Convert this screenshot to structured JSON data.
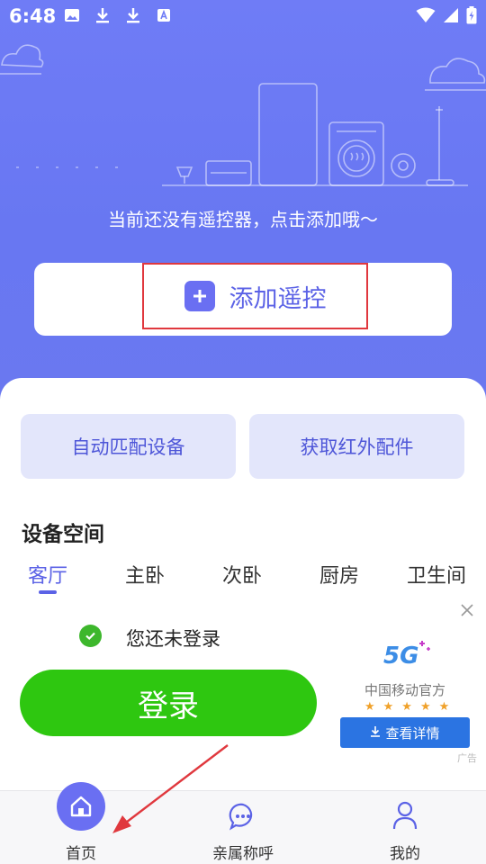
{
  "status_bar": {
    "time": "6:48"
  },
  "hero": {
    "hint": "当前还没有遥控器，点击添加哦～",
    "add_remote_label": "添加遥控"
  },
  "actions": {
    "auto_match": "自动匹配设备",
    "ir_accessory": "获取红外配件"
  },
  "rooms": {
    "title": "设备空间",
    "tabs": [
      "客厅",
      "主卧",
      "次卧",
      "厨房",
      "卫生间"
    ],
    "active": "客厅"
  },
  "ad": {
    "login_hint": "您还未登录",
    "login_button": "登录",
    "brand_name": "中国移动官方",
    "stars": "★★★★★",
    "detail_button": "查看详情",
    "ad_tag": "广告",
    "logo": "5G"
  },
  "nav": {
    "home": "首页",
    "family": "亲属称呼",
    "mine": "我的"
  },
  "colors": {
    "accent": "#5b62e6",
    "hero": "#6a78f0",
    "login_green": "#2ec710",
    "highlight_red": "#e0383e"
  }
}
